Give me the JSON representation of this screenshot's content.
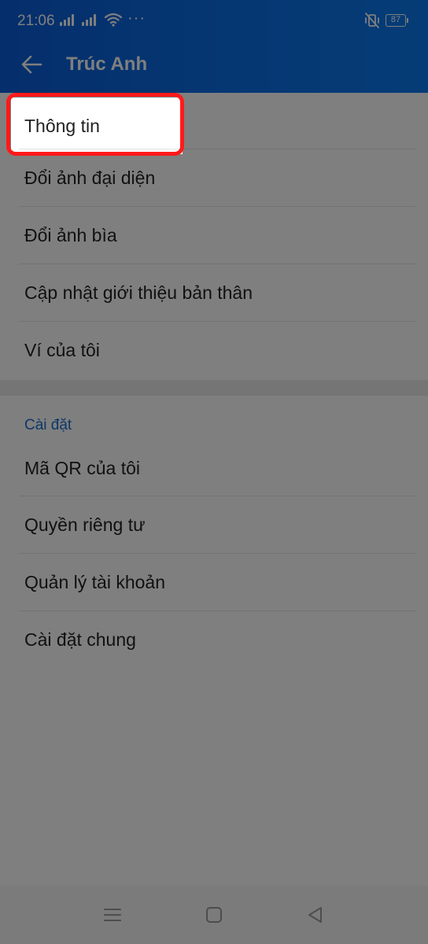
{
  "status_bar": {
    "time": "21:06",
    "more": "···",
    "battery": "87"
  },
  "header": {
    "title": "Trúc Anh"
  },
  "profile_items": [
    {
      "label": "Thông tin"
    },
    {
      "label": "Đổi ảnh đại diện"
    },
    {
      "label": "Đổi ảnh bìa"
    },
    {
      "label": "Cập nhật giới thiệu bản thân"
    },
    {
      "label": "Ví của tôi"
    }
  ],
  "settings": {
    "header": "Cài đặt",
    "items": [
      {
        "label": "Mã QR của tôi"
      },
      {
        "label": "Quyền riêng tư"
      },
      {
        "label": "Quản lý tài khoản"
      },
      {
        "label": "Cài đặt chung"
      }
    ]
  },
  "icons": {
    "back": "arrow-left-icon",
    "nav_menu": "menu-icon",
    "nav_home": "square-home-icon",
    "nav_back": "triangle-back-icon"
  },
  "colors": {
    "header_blue": "#0b6fe6",
    "section_header": "#1a6fd0",
    "highlight": "#ff1a1a"
  }
}
